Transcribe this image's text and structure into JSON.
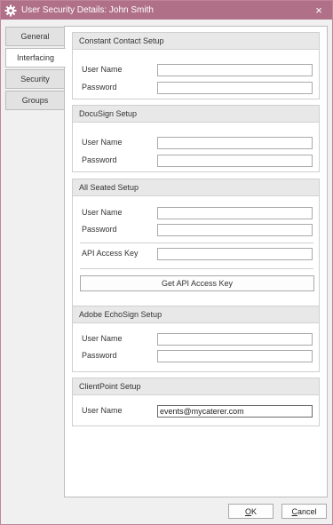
{
  "window": {
    "title": "User Security Details:  John Smith",
    "close_glyph": "×",
    "accent_color": "#b07088"
  },
  "tabs": [
    {
      "label": "General",
      "active": false
    },
    {
      "label": "Interfacing",
      "active": true
    },
    {
      "label": "Security",
      "active": false
    },
    {
      "label": "Groups",
      "active": false
    }
  ],
  "constant_contact": {
    "title": "Constant Contact Setup",
    "user_label": "User Name",
    "user_value": "",
    "password_label": "Password",
    "password_value": ""
  },
  "docusign": {
    "title": "DocuSign Setup",
    "user_label": "User Name",
    "user_value": "",
    "password_label": "Password",
    "password_value": ""
  },
  "all_seated": {
    "title": "All Seated Setup",
    "user_label": "User Name",
    "user_value": "",
    "password_label": "Password",
    "password_value": "",
    "api_key_label": "API Access Key",
    "api_key_value": "",
    "get_key_button": "Get API Access Key"
  },
  "adobe_echosign": {
    "title": "Adobe EchoSign Setup",
    "user_label": "User Name",
    "user_value": "",
    "password_label": "Password",
    "password_value": ""
  },
  "clientpoint": {
    "title": "ClientPoint Setup",
    "user_label": "User Name",
    "user_value": "events@mycaterer.com"
  },
  "footer": {
    "ok_first": "O",
    "ok_rest": "K",
    "cancel_first": "C",
    "cancel_rest": "ancel"
  }
}
